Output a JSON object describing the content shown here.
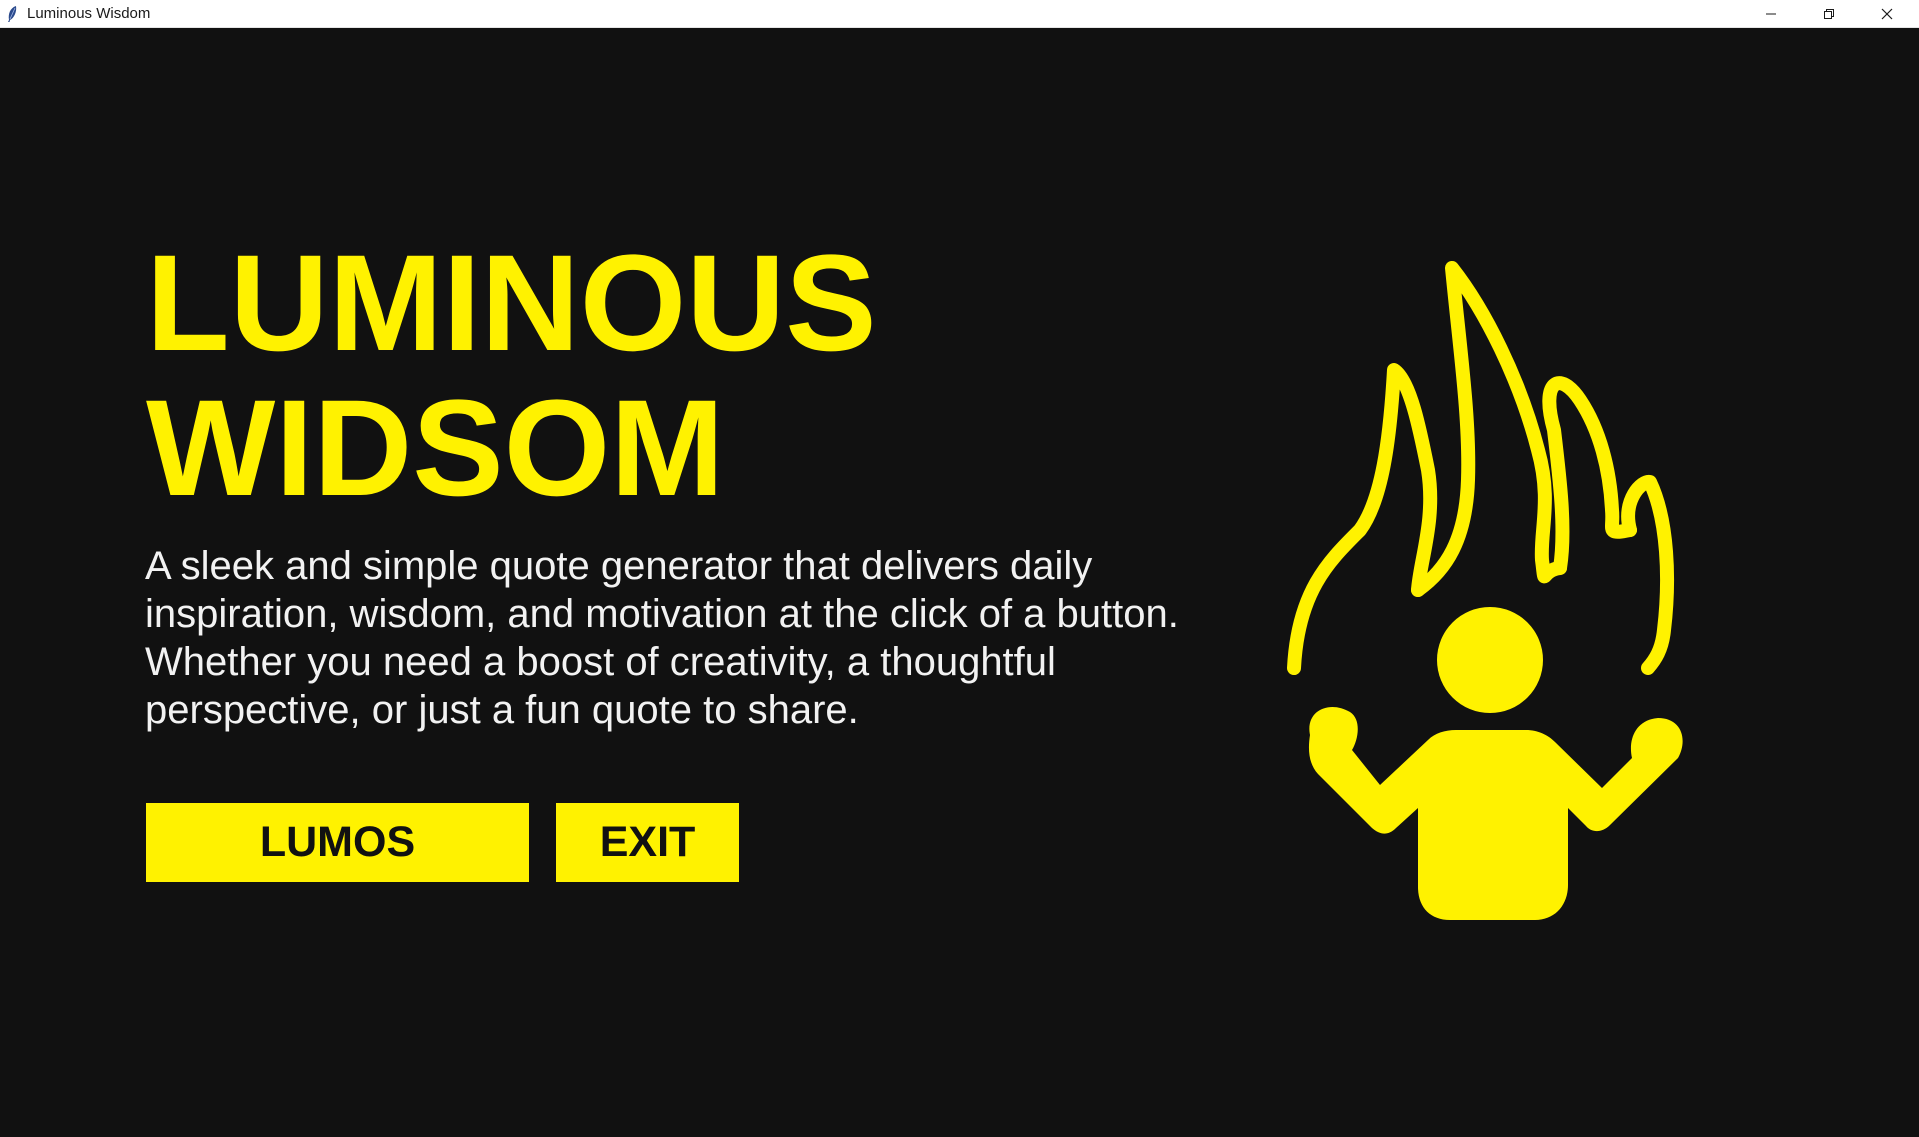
{
  "window": {
    "title": "Luminous Wisdom",
    "controls": [
      "minimize-icon",
      "restore-icon",
      "close-icon"
    ]
  },
  "hero": {
    "title_line1": "LUMINOUS",
    "title_line2": "WIDSOM",
    "description_lines": [
      "A sleek and simple quote generator that delivers daily",
      "inspiration, wisdom, and motivation at the click of a button.",
      "Whether you need a boost of creativity, a thoughtful",
      "perspective, or just a fun quote to share."
    ]
  },
  "buttons": {
    "lumos_label": "LUMOS",
    "exit_label": "EXIT"
  },
  "illustration": {
    "icon": "enlightened-person-flame-icon"
  },
  "colors": {
    "background": "#111111",
    "accent": "#fff200",
    "text": "#f2f2f2"
  }
}
